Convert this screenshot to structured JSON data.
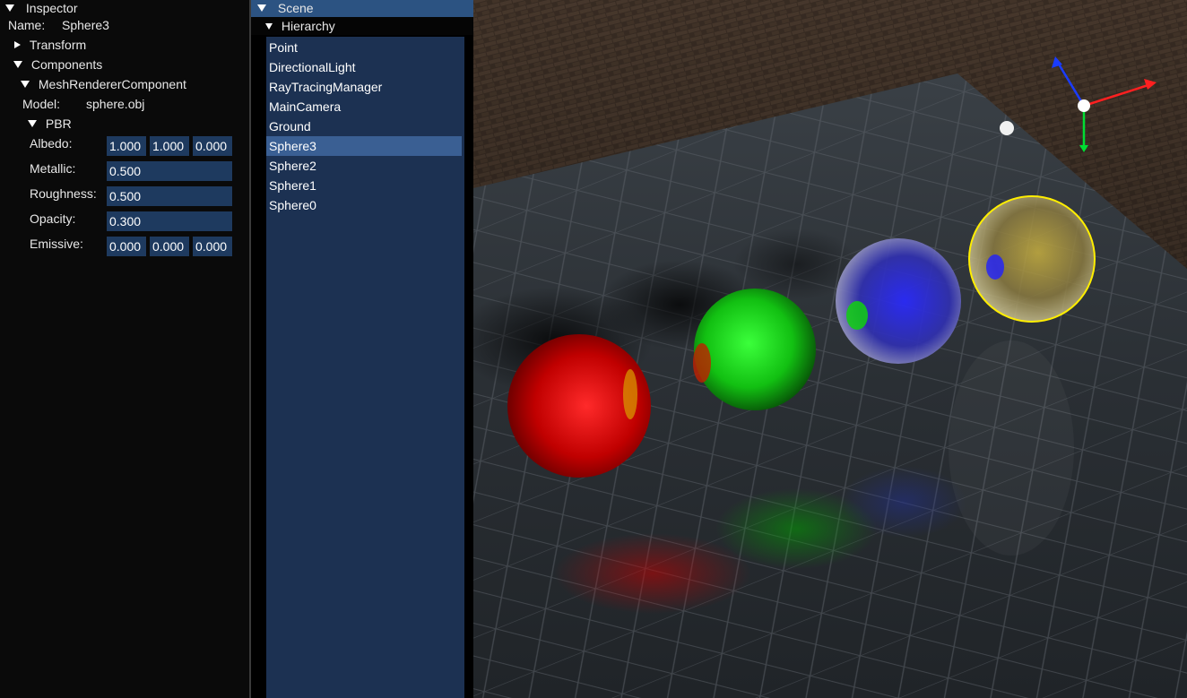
{
  "inspector": {
    "title": "Inspector",
    "name_label": "Name:",
    "name_value": "Sphere3",
    "transform_label": "Transform",
    "components_label": "Components",
    "mesh_renderer_label": "MeshRendererComponent",
    "model_label": "Model:",
    "model_value": "sphere.obj",
    "pbr_label": "PBR",
    "albedo_label": "Albedo:",
    "albedo": [
      "1.000",
      "1.000",
      "0.000"
    ],
    "metallic_label": "Metallic:",
    "metallic": "0.500",
    "roughness_label": "Roughness:",
    "roughness": "0.500",
    "opacity_label": "Opacity:",
    "opacity": "0.300",
    "emissive_label": "Emissive:",
    "emissive": [
      "0.000",
      "0.000",
      "0.000"
    ]
  },
  "scene": {
    "title": "Scene",
    "hierarchy_label": "Hierarchy",
    "items": [
      "Point",
      "DirectionalLight",
      "RayTracingManager",
      "MainCamera",
      "Ground",
      "Sphere3",
      "Sphere2",
      "Sphere1",
      "Sphere0"
    ],
    "selected": "Sphere3"
  },
  "colors": {
    "field_bg": "#1e3a5f",
    "selected_bg": "#3a5f93",
    "scene_title_bg": "#2c5382",
    "hierarchy_bg": "#1c3152",
    "gizmo_x": "#ff2020",
    "gizmo_y": "#00dd33",
    "gizmo_z": "#1a3cff",
    "selection_outline": "#ffee00"
  }
}
